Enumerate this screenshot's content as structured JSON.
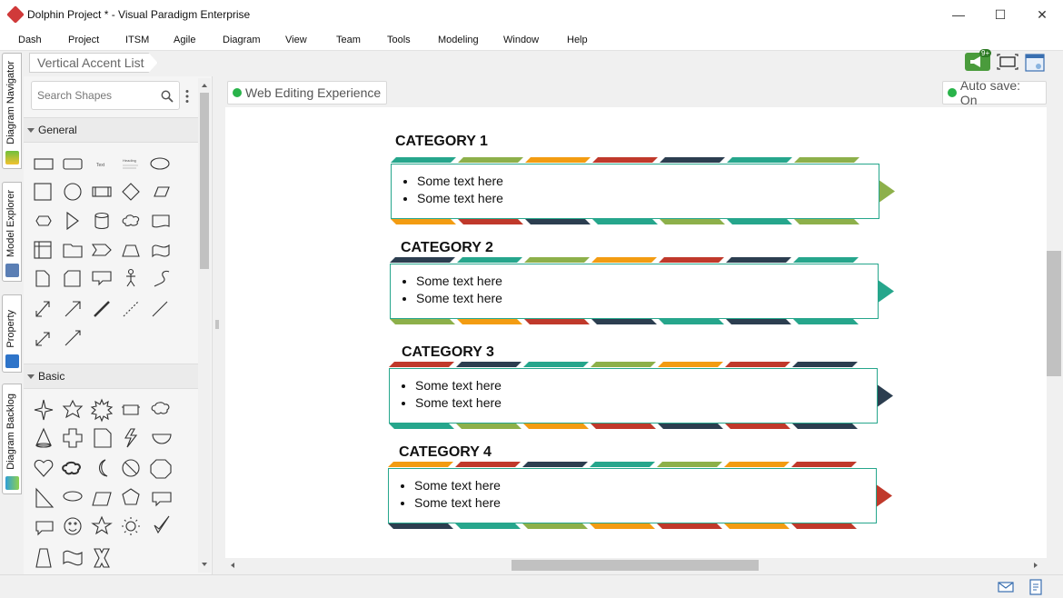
{
  "window": {
    "title": "Dolphin Project * - Visual Paradigm Enterprise",
    "controls": [
      "—",
      "☐",
      "✕"
    ]
  },
  "menu": [
    "Dash",
    "Project",
    "ITSM",
    "Agile",
    "Diagram",
    "View",
    "Team",
    "Tools",
    "Modeling",
    "Window",
    "Help"
  ],
  "breadcrumb": "Vertical Accent List",
  "left_tabs": [
    "Diagram Navigator",
    "Model Explorer",
    "Property",
    "Diagram Backlog"
  ],
  "shapes_panel": {
    "search_placeholder": "Search Shapes",
    "sections": [
      {
        "name": "General",
        "small_texts": [
          "Text",
          "Heading"
        ],
        "shapes": [
          "rectangle",
          "rounded-rectangle",
          "text",
          "heading",
          "ellipse",
          "square",
          "circle",
          "process",
          "diamond",
          "parallelogram",
          "hexagon",
          "triangle",
          "cylinder",
          "cloud",
          "document",
          "table",
          "folder",
          "chevron",
          "trapezoid",
          "wave",
          "page",
          "card",
          "callout",
          "actor",
          "curve",
          "double-arrow",
          "arrow",
          "thick-line",
          "dashed-line",
          "line",
          "connector-arrow",
          "line-arrow"
        ]
      },
      {
        "name": "Basic",
        "shapes": [
          "star-4",
          "star-5",
          "burst",
          "scroll",
          "cloud-callout",
          "cone",
          "cross",
          "folded-page",
          "lightning",
          "half-circle",
          "heart",
          "cloud",
          "moon",
          "no-symbol",
          "octagon",
          "right-triangle",
          "oval-callout",
          "parallelogram",
          "pentagon",
          "rect-callout",
          "speech-callout",
          "smiley",
          "star",
          "sun",
          "check",
          "trapezoid",
          "wave",
          "x-shape"
        ]
      }
    ]
  },
  "toolbar": {
    "left_pill": "Web Editing Experience",
    "right_pill": "Auto save: On",
    "notification_badge": "9+"
  },
  "colors": {
    "teal": "#26A68C",
    "green": "#8DB04A",
    "orange": "#F39C12",
    "red": "#C0392B",
    "navy": "#2C3E50"
  },
  "diagram": {
    "categories": [
      {
        "title": "CATEGORY 1",
        "items": [
          "Some text here",
          "Some text here"
        ],
        "accent": "#8DB04A",
        "border": "#26A68C"
      },
      {
        "title": "CATEGORY 2",
        "items": [
          "Some text here",
          "Some text here"
        ],
        "accent": "#26A68C",
        "border": "#26A68C"
      },
      {
        "title": "CATEGORY 3",
        "items": [
          "Some text here",
          "Some text here"
        ],
        "accent": "#2C3E50",
        "border": "#26A68C"
      },
      {
        "title": "CATEGORY 4",
        "items": [
          "Some text here",
          "Some text here"
        ],
        "accent": "#C0392B",
        "border": "#26A68C"
      }
    ]
  }
}
